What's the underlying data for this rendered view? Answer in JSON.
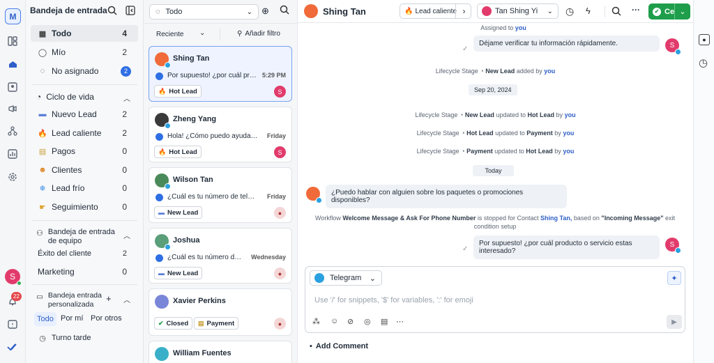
{
  "rail": {
    "logo": "M",
    "user_initial": "S",
    "notif_count": "22",
    "icons": [
      "layout-icon",
      "inbox-icon",
      "contacts-icon",
      "broadcast-icon",
      "workflow-icon",
      "reports-icon",
      "settings-icon",
      "help-icon",
      "check-icon"
    ]
  },
  "sidebar": {
    "title": "Bandeja de entrada",
    "items": [
      {
        "label": "Todo",
        "count": "4"
      },
      {
        "label": "Mío",
        "count": "2"
      },
      {
        "label": "No asignado",
        "count": "2"
      }
    ],
    "lifecycle": {
      "title": "Ciclo de vida",
      "items": [
        {
          "label": "Nuevo Lead",
          "count": "2"
        },
        {
          "label": "Lead caliente",
          "count": "2"
        },
        {
          "label": "Pagos",
          "count": "0"
        },
        {
          "label": "Clientes",
          "count": "0"
        },
        {
          "label": "Lead frío",
          "count": "0"
        },
        {
          "label": "Seguimiento",
          "count": "0"
        }
      ]
    },
    "team": {
      "title_line1": "Bandeja de entrada",
      "title_line2": "de equipo",
      "items": [
        {
          "label": "Éxito del cliente",
          "count": "2"
        },
        {
          "label": "Marketing",
          "count": "0"
        }
      ]
    },
    "custom": {
      "title_line1": "Bandeja entrada",
      "title_line2": "personalizada",
      "tabs": [
        "Todo",
        "Por mí",
        "Por otros"
      ],
      "items": [
        {
          "label": "Turno tarde"
        }
      ]
    }
  },
  "list": {
    "filter": "Todo",
    "sort": "Reciente",
    "add_filter": "Añadir filtro",
    "cards": [
      {
        "name": "Shing Tan",
        "preview": "Por supuesto! ¿por cuál producto o servicio estas interesado?",
        "time": "5:29 PM",
        "tags": [
          "Hot Lead"
        ],
        "user": "S"
      },
      {
        "name": "Zheng Yang",
        "preview": "Hola! ¿Cómo puedo ayudarte?",
        "time": "Friday",
        "tags": [
          "Hot Lead"
        ],
        "user": "S"
      },
      {
        "name": "Wilson Tan",
        "preview": "¿Cuál es tu número de teléfono?",
        "time": "Friday",
        "tags": [
          "New Lead"
        ],
        "user": ""
      },
      {
        "name": "Joshua",
        "preview": "¿Cuál es tu número de teléfono?",
        "time": "Wednesday",
        "tags": [
          "New Lead"
        ],
        "user": ""
      },
      {
        "name": "Xavier Perkins",
        "preview": "",
        "time": "",
        "tags": [
          "Closed",
          "Payment"
        ],
        "user": ""
      },
      {
        "name": "William Fuentes",
        "preview": "",
        "time": "",
        "tags": [],
        "user": ""
      }
    ]
  },
  "chat": {
    "contact": "Shing Tan",
    "lifecycle": "Lead caliente",
    "assignee": "Tan Shing Yi",
    "close": "Cerrar",
    "assigned_prefix": "Assigned to",
    "assigned_user": "you",
    "msg_out_1": "Déjame verificar tu información rápidamente.",
    "events": [
      {
        "pre": "Lifecycle Stage",
        "a": "New Lead",
        "mid": "added by",
        "b": "",
        "user": "you"
      },
      {
        "pre": "Lifecycle Stage",
        "a": "New Lead",
        "mid": "updated to",
        "b": "Hot Lead",
        "user": "you"
      },
      {
        "pre": "Lifecycle Stage",
        "a": "Hot Lead",
        "mid": "updated to",
        "b": "Payment",
        "user": "you"
      },
      {
        "pre": "Lifecycle Stage",
        "a": "Payment",
        "mid": "updated to",
        "b": "Hot Lead",
        "user": "you"
      }
    ],
    "date1": "Sep 20, 2024",
    "date2": "Today",
    "msg_in_1": "¿Puedo hablar con alguien sobre los paquetes o promociones disponibles?",
    "wf": {
      "p1": "Workflow",
      "name": "Welcome Message & Ask For Phone Number",
      "p2": "is stopped for Contact",
      "contact": "Shing Tan,",
      "p3": "based on",
      "trigger": "\"Incoming Message\"",
      "p4": "exit",
      "line2": "condition setup"
    },
    "msg_out_2": "Por supuesto! ¿por cuál producto o servicio estas interesado?",
    "composer": {
      "channel": "Telegram",
      "placeholder": "Use '/' for snippets, '$' for variables, ':' for emoji"
    },
    "add_comment": "Add Comment"
  }
}
